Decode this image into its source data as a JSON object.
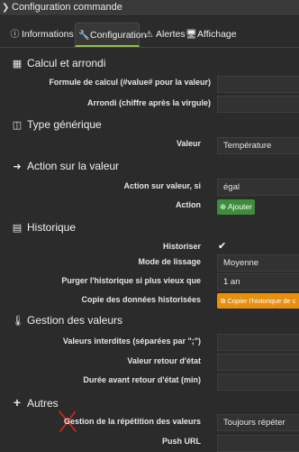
{
  "window": {
    "title": "Configuration commande"
  },
  "tabs": [
    {
      "label": "Informations",
      "icon": "info-circle-icon"
    },
    {
      "label": "Configuration",
      "icon": "wrench-icon"
    },
    {
      "label": "Alertes",
      "icon": "warning-icon"
    },
    {
      "label": "Affichage",
      "icon": "desktop-icon"
    }
  ],
  "sections": {
    "calcul": {
      "title": "Calcul et arrondi",
      "formule_label": "Formule de calcul (#value# pour la valeur)",
      "formule_value": "",
      "arrondi_label": "Arrondi (chiffre après la virgule)",
      "arrondi_value": ""
    },
    "type": {
      "title": "Type générique",
      "valeur_label": "Valeur",
      "valeur_value": "Température"
    },
    "action": {
      "title": "Action sur la valeur",
      "action_si_label": "Action sur valeur, si",
      "action_si_value": "égal",
      "action_label": "Action",
      "ajouter_label": "Ajouter"
    },
    "historique": {
      "title": "Historique",
      "historiser_label": "Historiser",
      "historiser_checked": true,
      "lissage_label": "Mode de lissage",
      "lissage_value": "Moyenne",
      "purger_label": "Purger l'historique si plus vieux que",
      "purger_value": "1 an",
      "copie_label": "Copie des données historisées",
      "copie_button": "Copier l'historique de c"
    },
    "gestion": {
      "title": "Gestion des valeurs",
      "interdites_label": "Valeurs interdites (séparées par \";\")",
      "retour_label": "Valeur retour d'état",
      "duree_label": "Durée avant retour d'état (min)"
    },
    "autres": {
      "title": "Autres",
      "repetition_label": "Gestion de la répétition des valeurs",
      "repetition_value": "Toujours répéter",
      "push_label": "Push URL"
    }
  },
  "colors": {
    "accent_green": "#3d8c3b",
    "accent_orange": "#e8900c",
    "annotation_red": "#d9261c"
  }
}
